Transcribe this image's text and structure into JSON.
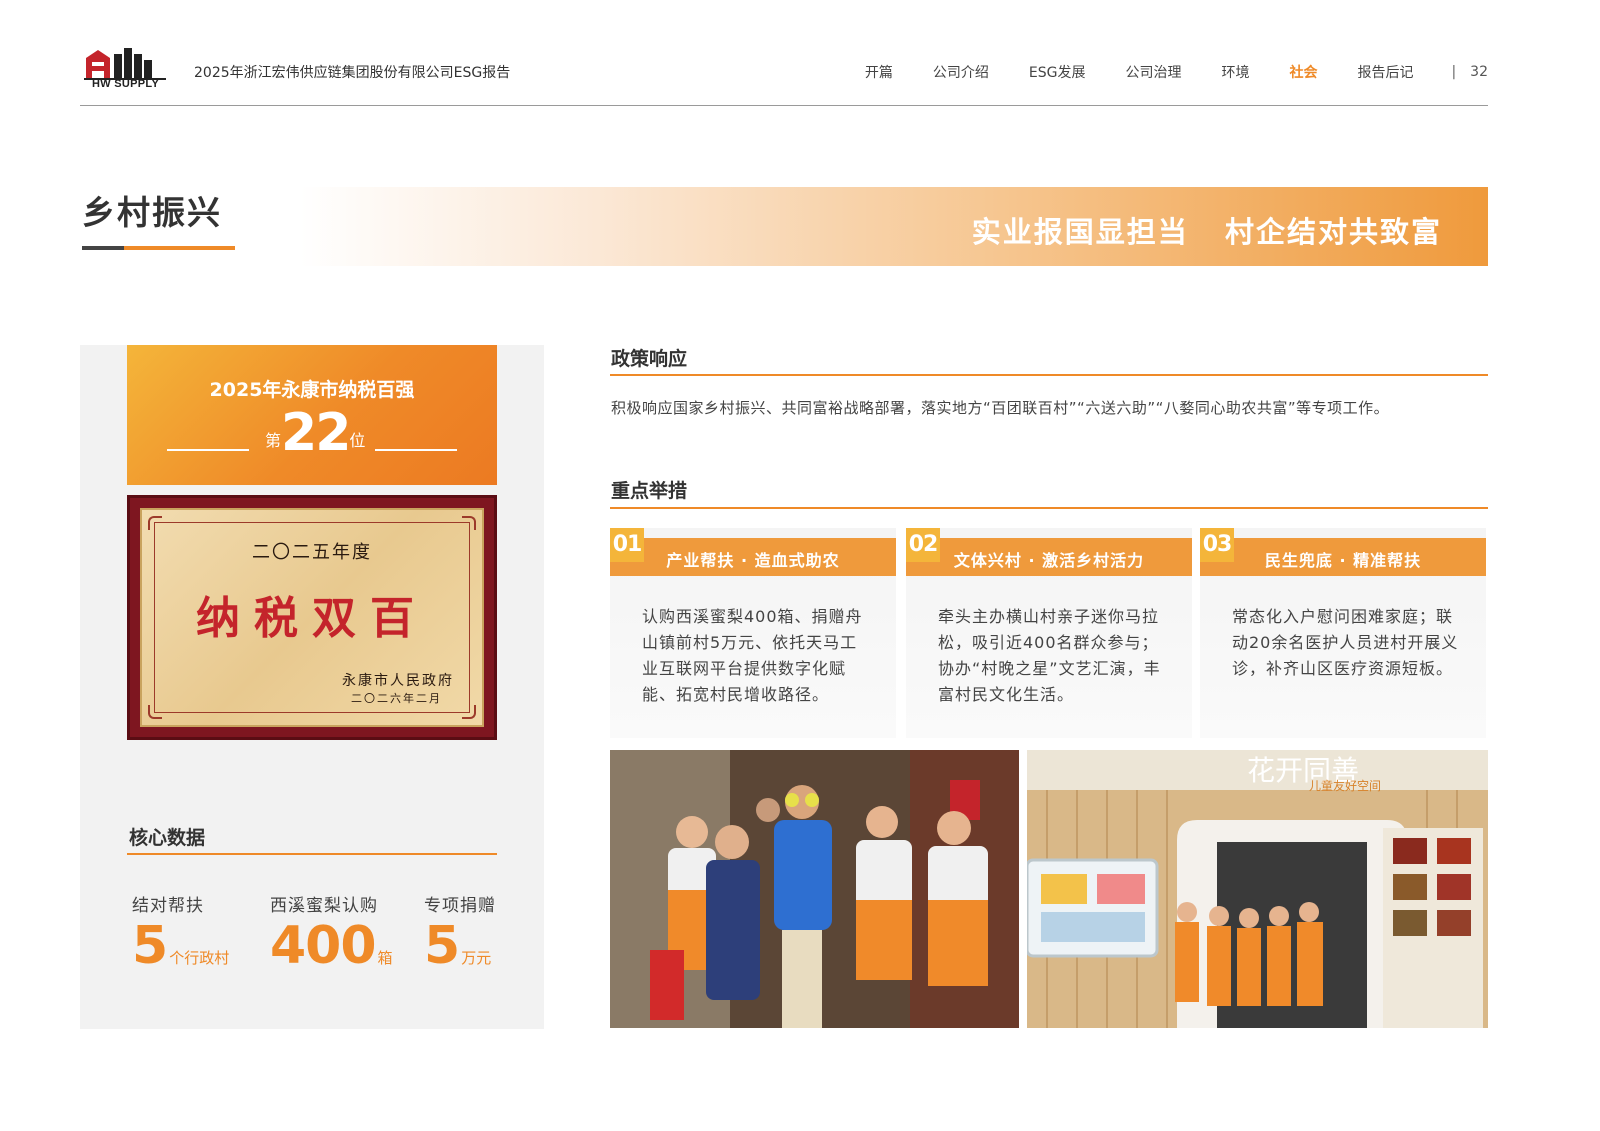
{
  "header": {
    "logo_text": "HW SUPPLY",
    "report_title": "2025年浙江宏伟供应链集团股份有限公司ESG报告",
    "nav": [
      "开篇",
      "公司介绍",
      "ESG发展",
      "公司治理",
      "环境",
      "社会",
      "报告后记"
    ],
    "active_nav": "社会",
    "separator": "|",
    "page_number": "32"
  },
  "section": {
    "title": "乡村振兴",
    "banner": "实业报国显担当   村企结对共致富"
  },
  "rank": {
    "title": "2025年永康市纳税百强",
    "prefix": "第",
    "number": "22",
    "suffix": "位"
  },
  "plaque": {
    "year": "二〇二五年度",
    "main": "纳税双百",
    "issuer": "永康市人民政府",
    "date": "二〇二六年二月"
  },
  "core": {
    "title": "核心数据",
    "stats": [
      {
        "label": "结对帮扶",
        "value": "5",
        "unit": "个行政村"
      },
      {
        "label": "西溪蜜梨认购",
        "value": "400",
        "unit": "箱"
      },
      {
        "label": "专项捐赠",
        "value": "5",
        "unit": "万元"
      }
    ]
  },
  "policy": {
    "title": "政策响应",
    "text": "积极响应国家乡村振兴、共同富裕战略部署，落实地方“百团联百村”“六送六助”“八婺同心助农共富”等专项工作。"
  },
  "measures": {
    "title": "重点举措",
    "cards": [
      {
        "num": "01",
        "title": "产业帮扶 · 造血式助农",
        "body": "认购西溪蜜梨400箱、捐赠舟山镇前村5万元、依托天马工业互联网平台提供数字化赋能、拓宽村民增收路径。"
      },
      {
        "num": "02",
        "title": "文体兴村 · 激活乡村活力",
        "body": "牵头主办横山村亲子迷你马拉松，吸引近400名群众参与；协办“村晚之星”文艺汇演，丰富村民文化生活。"
      },
      {
        "num": "03",
        "title": "民生兜底 · 精准帮扶",
        "body": "常态化入户慰问困难家庭；联动20余名医护人员进村开展义诊，补齐山区医疗资源短板。"
      }
    ]
  },
  "photo_sign": {
    "text": "花开同善",
    "subtext": "儿童友好空间"
  },
  "colors": {
    "accent": "#ef8a28",
    "accent_light": "#f4b53a",
    "text": "#333333",
    "panel_bg": "#f2f2f2"
  }
}
